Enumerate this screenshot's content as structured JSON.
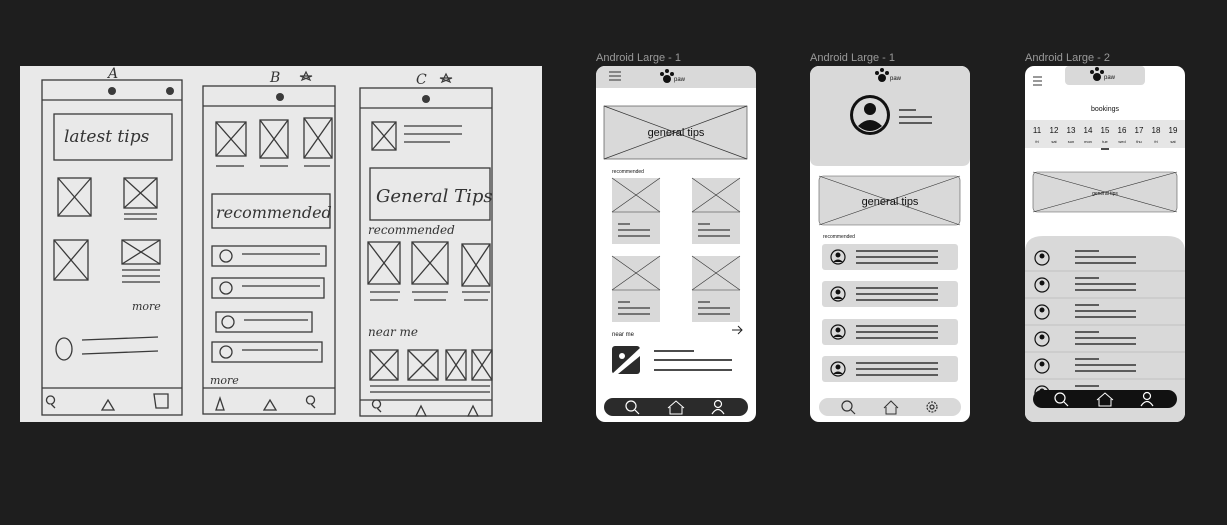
{
  "sketch": {
    "labels": [
      "A",
      "B",
      "C"
    ],
    "a_latest_tips": "latest tips",
    "a_more": "more",
    "b_recommended": "recommended",
    "b_more": "more",
    "c_general_tips": "General Tips",
    "c_recommended": "recommended",
    "c_near_me": "near me"
  },
  "frames": [
    {
      "label": "Android Large - 1",
      "logo_text": "paw",
      "banner": "general tips",
      "section": "recommended",
      "near_me": "near me",
      "nav_icons": [
        "search-icon",
        "home-icon",
        "profile-icon"
      ]
    },
    {
      "label": "Android Large - 1",
      "logo_text": "paw",
      "banner": "general tips",
      "section": "recommended",
      "nav_icons": [
        "search-icon",
        "home-icon",
        "settings-icon"
      ]
    },
    {
      "label": "Android Large - 2",
      "logo_text": "paw",
      "title": "bookings",
      "days": [
        {
          "num": "11",
          "day": "fri"
        },
        {
          "num": "12",
          "day": "sat"
        },
        {
          "num": "13",
          "day": "sun"
        },
        {
          "num": "14",
          "day": "mon"
        },
        {
          "num": "15",
          "day": "tue"
        },
        {
          "num": "16",
          "day": "wed"
        },
        {
          "num": "17",
          "day": "thu"
        },
        {
          "num": "18",
          "day": "fri"
        },
        {
          "num": "19",
          "day": "sat"
        }
      ],
      "banner": "general tips",
      "nav_icons": [
        "search-icon",
        "home-icon",
        "profile-icon"
      ]
    }
  ],
  "colors": {
    "canvas": "#1e1e1e",
    "frame_bg": "#ffffff",
    "placeholder": "#d9d9d9",
    "nav_bar": "#2b2b2b",
    "label": "#9a9a9a"
  }
}
